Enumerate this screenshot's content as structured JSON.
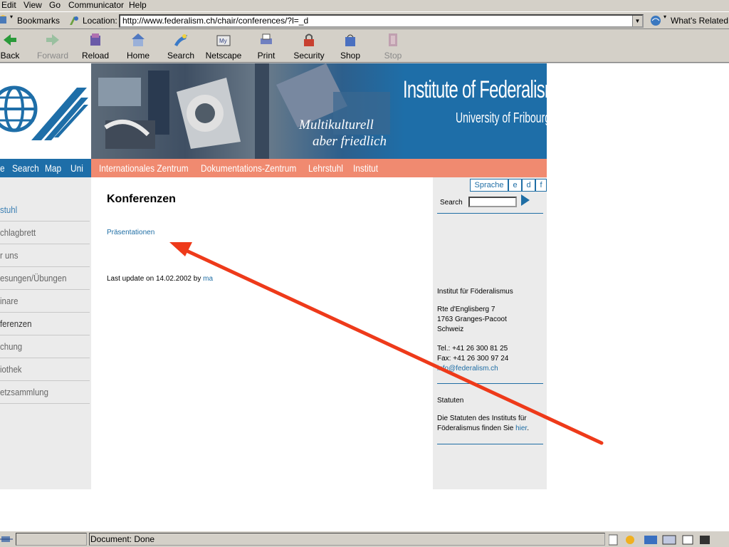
{
  "menu": [
    "Edit",
    "View",
    "Go",
    "Communicator",
    "Help"
  ],
  "location_bar": {
    "bookmarks_label": "Bookmarks",
    "location_label": "Location:",
    "url": "http://www.federalism.ch/chair/conferences/?l=_d",
    "whats_related": "What's Related"
  },
  "toolbar": {
    "buttons": [
      "Back",
      "Forward",
      "Reload",
      "Home",
      "Search",
      "Netscape",
      "Print",
      "Security",
      "Shop",
      "Stop"
    ]
  },
  "banner": {
    "institute": "Institute of Federalism",
    "university": "University of Fribourg",
    "motto_line1": "Multikulturell",
    "motto_line2": "aber friedlich"
  },
  "left_nav_bar": [
    "e",
    "Search",
    "Map",
    "Uni"
  ],
  "top_nav": [
    "Internationales Zentrum",
    "Dokumentations-Zentrum",
    "Lehrstuhl",
    "Institut"
  ],
  "sidebar_items": [
    "stuhl",
    "chlagbrett",
    "r uns",
    "esungen/Übungen",
    "inare",
    "ferenzen",
    "chung",
    "iothek",
    "etzsammlung"
  ],
  "main": {
    "title": "Konferenzen",
    "link": "Präsentationen",
    "update_text": "Last update on 14.02.2002 by",
    "update_by": "ma"
  },
  "right_col": {
    "sprache": "Sprache",
    "langs": [
      "e",
      "d",
      "f"
    ],
    "search_label": "Search",
    "org": "Institut für Föderalismus",
    "addr1": "Rte d'Englisberg 7",
    "addr2": "1763 Granges-Pacoot",
    "addr3": "Schweiz",
    "tel": "Tel.: +41 26 300 81 25",
    "fax": "Fax: +41 26 300 97 24",
    "email": "info@federalism.ch",
    "statuten_title": "Statuten",
    "statuten_text1": "Die Statuten des Instituts für",
    "statuten_text2": "Föderalismus finden Sie",
    "statuten_link": "hier",
    "statuten_end": "."
  },
  "status": {
    "text": "Document: Done"
  },
  "colors": {
    "banner_blue": "#1e6ea8",
    "nav_salmon": "#f08a70",
    "link_blue": "#1f6ea5",
    "annotation_arrow": "#ee3a1a"
  }
}
